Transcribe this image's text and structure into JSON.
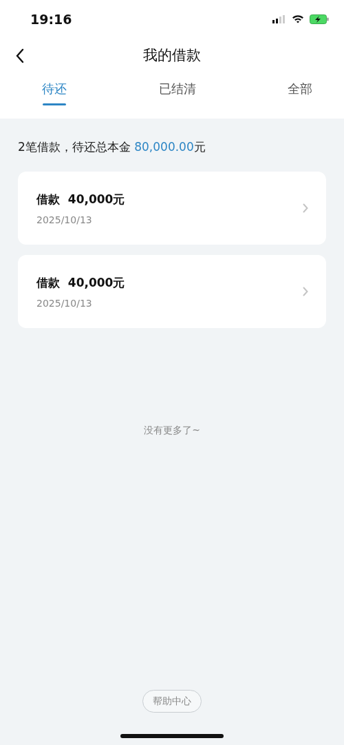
{
  "status_bar": {
    "time": "19:16"
  },
  "nav": {
    "title": "我的借款"
  },
  "tabs": [
    {
      "label": "待还",
      "selected": true
    },
    {
      "label": "已结清",
      "selected": false
    },
    {
      "label": "全部",
      "selected": false
    }
  ],
  "summary": {
    "text": "2笔借款，待还总本金",
    "amount": "80,000.00",
    "unit": "元"
  },
  "loans": [
    {
      "label": "借款",
      "amount": "40,000元",
      "date": "2025/10/13"
    },
    {
      "label": "借款",
      "amount": "40,000元",
      "date": "2025/10/13"
    }
  ],
  "end_note": "没有更多了~",
  "help_button": "帮助中心"
}
